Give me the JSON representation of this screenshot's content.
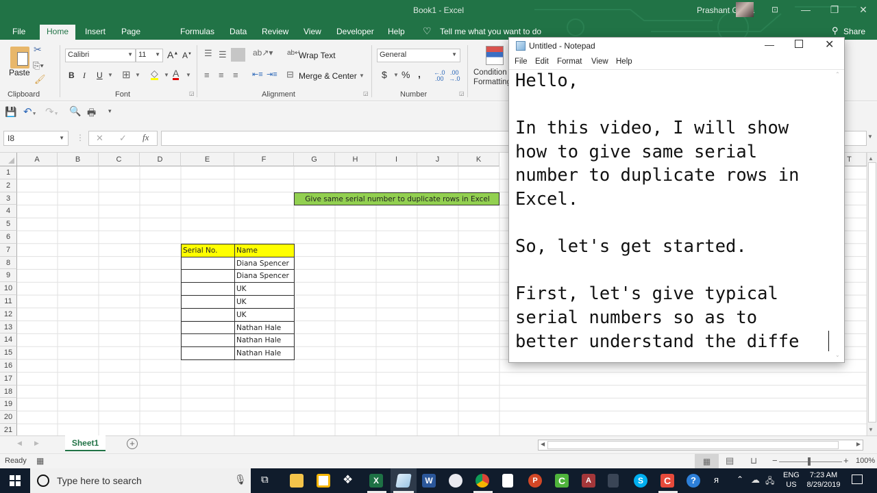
{
  "excel": {
    "window_title": "Book1  -  Excel",
    "user_name": "Prashant Gupta",
    "tabs": [
      "File",
      "Home",
      "Insert",
      "Page Layout",
      "Formulas",
      "Data",
      "Review",
      "View",
      "Developer",
      "Help"
    ],
    "active_tab": "Home",
    "tell_me": "Tell me what you want to do",
    "share": "Share",
    "ribbon": {
      "clipboard": {
        "label": "Clipboard",
        "paste": "Paste"
      },
      "font": {
        "label": "Font",
        "font_name": "Calibri",
        "font_size": "11",
        "bold": "B",
        "italic": "I",
        "underline": "U"
      },
      "alignment": {
        "label": "Alignment",
        "wrap_text": "Wrap Text",
        "merge_center": "Merge & Center"
      },
      "number": {
        "label": "Number",
        "format": "General",
        "currency": "$",
        "percent": "%",
        "comma": ","
      },
      "styles": {
        "conditional_formatting_line1": "Condition",
        "conditional_formatting_line2": "Formatting"
      }
    },
    "name_box": "I8",
    "formula_bar_value": "",
    "columns": [
      "A",
      "B",
      "C",
      "D",
      "E",
      "F",
      "G",
      "H",
      "I",
      "J",
      "K",
      "T"
    ],
    "rows": [
      "1",
      "2",
      "3",
      "4",
      "5",
      "6",
      "7",
      "8",
      "9",
      "10",
      "11",
      "12",
      "13",
      "14",
      "15",
      "16",
      "17",
      "18",
      "19",
      "20",
      "21"
    ],
    "cells": {
      "G3": "Give same serial number to duplicate rows in Excel",
      "E7": "Serial No.",
      "F7": "Name",
      "F8": "Diana Spencer",
      "F9": "Diana Spencer",
      "F10": "UK",
      "F11": "UK",
      "F12": "UK",
      "F13": "Nathan Hale",
      "F14": "Nathan Hale",
      "F15": "Nathan Hale"
    },
    "colors": {
      "title_green": "#217346",
      "header_fill": "#ffff00",
      "title_fill": "#92d050"
    },
    "sheet_tab": "Sheet1",
    "status": "Ready",
    "zoom_level": "100%"
  },
  "notepad": {
    "title": "Untitled - Notepad",
    "menu": [
      "File",
      "Edit",
      "Format",
      "View",
      "Help"
    ],
    "text": "Hello,\n\nIn this video, I will show\nhow to give same serial\nnumber to duplicate rows in\nExcel.\n\nSo, let's get started.\n\nFirst, let's give typical\nserial numbers so as to\nbetter understand the diffe"
  },
  "taskbar": {
    "search_placeholder": "Type here to search",
    "lang_line1": "ENG",
    "lang_line2": "US",
    "time": "7:23 AM",
    "date": "8/29/2019"
  }
}
